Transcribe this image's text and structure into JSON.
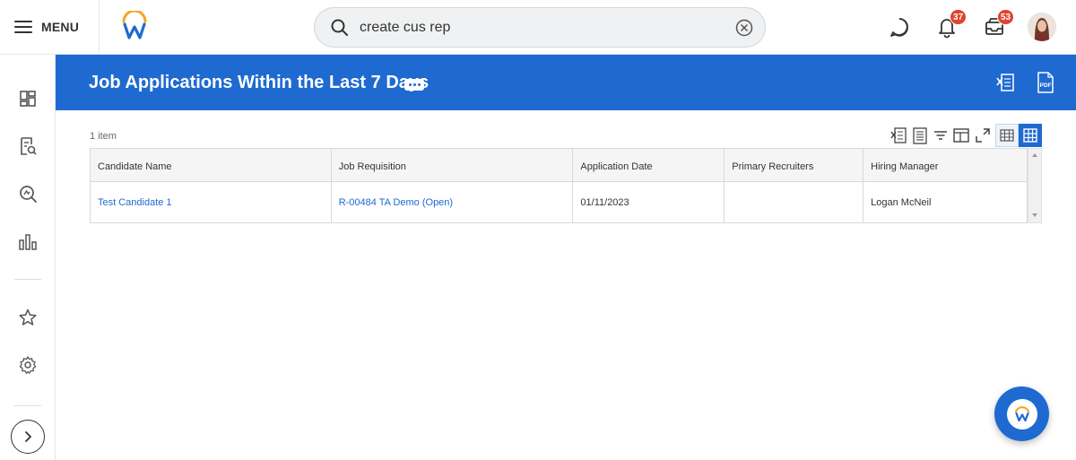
{
  "topbar": {
    "menu_label": "MENU",
    "search": {
      "value": "create cus rep",
      "placeholder": "Search"
    },
    "notifications_count": "37",
    "inbox_count": "53"
  },
  "page": {
    "title": "Job Applications Within the Last 7 Days",
    "item_count": "1 item"
  },
  "table": {
    "columns": [
      "Candidate Name",
      "Job Requisition",
      "Application Date",
      "Primary Recruiters",
      "Hiring Manager"
    ],
    "rows": [
      {
        "candidate_name": "Test Candidate 1",
        "job_requisition": "R-00484 TA Demo (Open)",
        "application_date": "01/11/2023",
        "primary_recruiters": "",
        "hiring_manager": "Logan McNeil"
      }
    ]
  },
  "icons": {
    "left_nav": [
      "dashboard-icon",
      "report-search-icon",
      "search-analytics-icon",
      "bar-chart-icon",
      "star-icon",
      "gear-icon"
    ],
    "header": [
      "export-excel-icon",
      "export-pdf-icon"
    ],
    "toolbar": [
      "export-excel-icon",
      "print-icon",
      "filter-icon",
      "columns-icon",
      "fullscreen-icon",
      "table-view-icon",
      "grid-view-icon"
    ]
  },
  "colors": {
    "brand_blue": "#1e6ad1",
    "badge_red": "#de4431",
    "logo_orange": "#f5a623"
  }
}
